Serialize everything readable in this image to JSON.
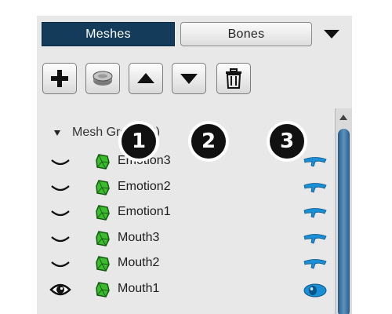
{
  "tabs": {
    "meshes_label": "Meshes",
    "bones_label": "Bones"
  },
  "toolbar": {
    "add": "plus-icon",
    "mesh": "mesh-disc-icon",
    "move_up": "triangle-up-icon",
    "move_down": "triangle-down-icon",
    "delete": "trash-icon"
  },
  "group": {
    "label": "Mesh Group (0)"
  },
  "rows": [
    {
      "name": "Emotion3",
      "visible": false
    },
    {
      "name": "Emotion2",
      "visible": false
    },
    {
      "name": "Emotion1",
      "visible": false
    },
    {
      "name": "Mouth3",
      "visible": false
    },
    {
      "name": "Mouth2",
      "visible": false
    },
    {
      "name": "Mouth1",
      "visible": true
    }
  ],
  "callouts": [
    "1",
    "2",
    "3"
  ],
  "colors": {
    "active_tab": "#143c5a",
    "mesh_icon": "#3dbb2f",
    "lens_icon": "#1b8fd6"
  }
}
